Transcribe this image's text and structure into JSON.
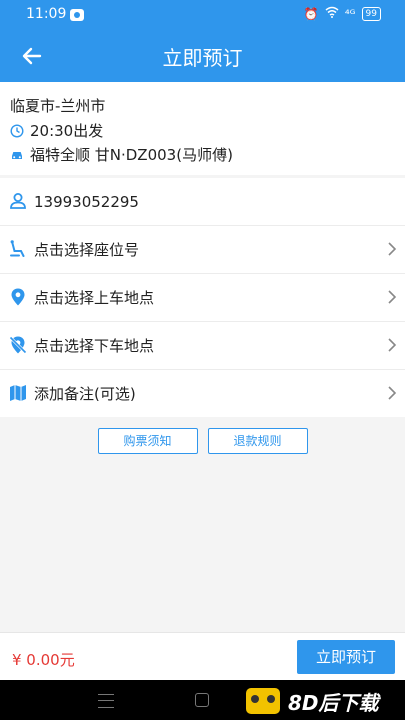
{
  "status_bar": {
    "time": "11:09",
    "signal": "⁴ᴳ",
    "battery": "99"
  },
  "header": {
    "title": "立即预订"
  },
  "trip": {
    "route": "临夏市-兰州市",
    "departure": "20:30出发",
    "vehicle": "福特全顺 甘N·DZ003(马师傅)"
  },
  "list": [
    {
      "icon": "person-icon",
      "label": "13993052295",
      "chevron": false
    },
    {
      "icon": "seat-icon",
      "label": "点击选择座位号",
      "chevron": true
    },
    {
      "icon": "location-pin-icon",
      "label": "点击选择上车地点",
      "chevron": true
    },
    {
      "icon": "location-off-icon",
      "label": "点击选择下车地点",
      "chevron": true
    },
    {
      "icon": "map-icon",
      "label": "添加备注(可选)",
      "chevron": true
    }
  ],
  "links": {
    "notice": "购票须知",
    "refund": "退款规则"
  },
  "footer": {
    "price": "¥ 0.00元",
    "book_button": "立即预订"
  },
  "watermark": {
    "text": "8D后下载"
  },
  "colors": {
    "primary": "#2f96ec",
    "price": "#e53935"
  }
}
